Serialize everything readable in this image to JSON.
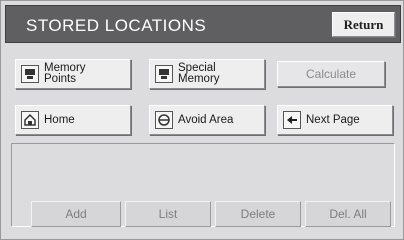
{
  "header": {
    "title": "STORED LOCATIONS",
    "return_label": "Return"
  },
  "menu": {
    "memory_points": {
      "line1": "Memory",
      "line2": "Points",
      "icon": "memory-points-icon"
    },
    "special_memory": {
      "line1": "Special",
      "line2": "Memory",
      "icon": "special-memory-icon"
    },
    "calculate": "Calculate",
    "home": {
      "label": "Home",
      "icon": "home-icon"
    },
    "avoid_area": {
      "label": "Avoid Area",
      "icon": "avoid-area-icon"
    },
    "next_page": {
      "label": "Next Page",
      "icon": "arrow-left-icon"
    }
  },
  "actions": {
    "add": "Add",
    "list": "List",
    "delete": "Delete",
    "del_all": "Del. All"
  },
  "colors": {
    "titlebar": "#5f5f62",
    "background": "#dcdcde",
    "disabled_text": "#8a8a8d"
  }
}
